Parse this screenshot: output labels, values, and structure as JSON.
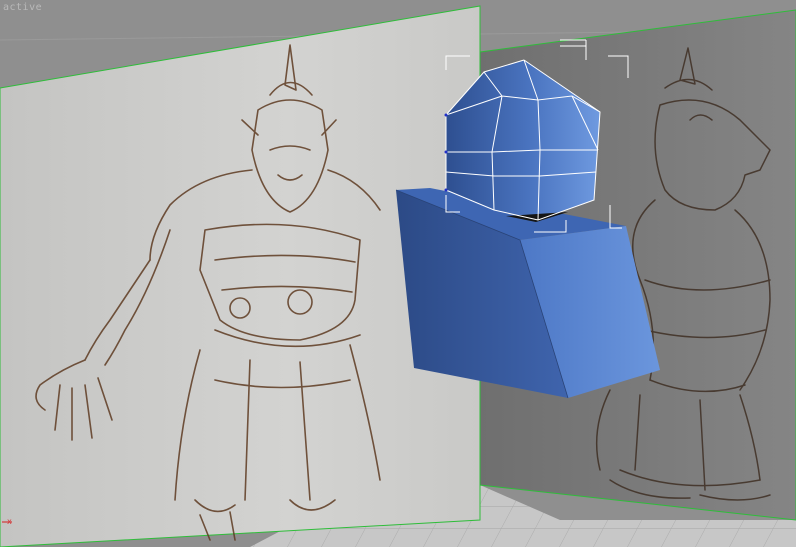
{
  "viewport": {
    "label": "active",
    "mode": "perspective",
    "colors": {
      "background": "#8f8f8f",
      "grid_line": "#9c9c9c",
      "floor": "#c7c7c7",
      "left_plane": "#cfcfcd",
      "right_plane": "#7b7b7b",
      "plane_edge": "#2fbd3a",
      "mesh_blue": "#4f79c4",
      "mesh_blue_dark": "#2f4f8f",
      "mesh_blue_light": "#6e9be0",
      "wire_white": "#ffffff",
      "axis_x": "#d33a3a",
      "sketch_ink": "#5e3b22"
    }
  },
  "scene": {
    "objects": [
      {
        "name": "reference-plane-front",
        "type": "plane",
        "texture": "front-view-sketch"
      },
      {
        "name": "reference-plane-side",
        "type": "plane",
        "texture": "side-view-sketch"
      },
      {
        "name": "head-mesh",
        "type": "editable-poly",
        "selected": true
      },
      {
        "name": "torso-box",
        "type": "box",
        "selected": false
      }
    ],
    "gizmo": {
      "type": "selection-brackets",
      "target": "head-mesh"
    },
    "axis_tripod": {
      "visible": true,
      "axis": "x"
    }
  }
}
